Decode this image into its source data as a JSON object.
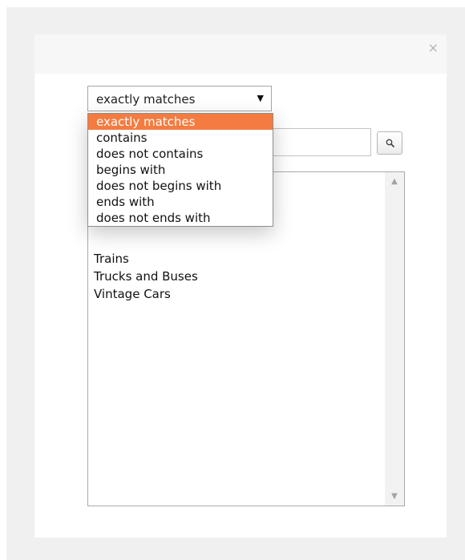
{
  "dialog": {
    "close_label": "×"
  },
  "operator": {
    "selected": "exactly matches",
    "arrow": "▼",
    "options": [
      "exactly matches",
      "contains",
      "does not contains",
      "begins with",
      "does not begins with",
      "ends with",
      "does not ends with"
    ]
  },
  "search": {
    "value": "",
    "button_icon": "magnifier-icon"
  },
  "list": {
    "items": [
      "Trains",
      "Trucks and Buses",
      "Vintage Cars"
    ],
    "scroll_up": "▲",
    "scroll_down": "▼"
  },
  "colors": {
    "highlight": "#f47c40",
    "backdrop": "#f0f0f0"
  }
}
